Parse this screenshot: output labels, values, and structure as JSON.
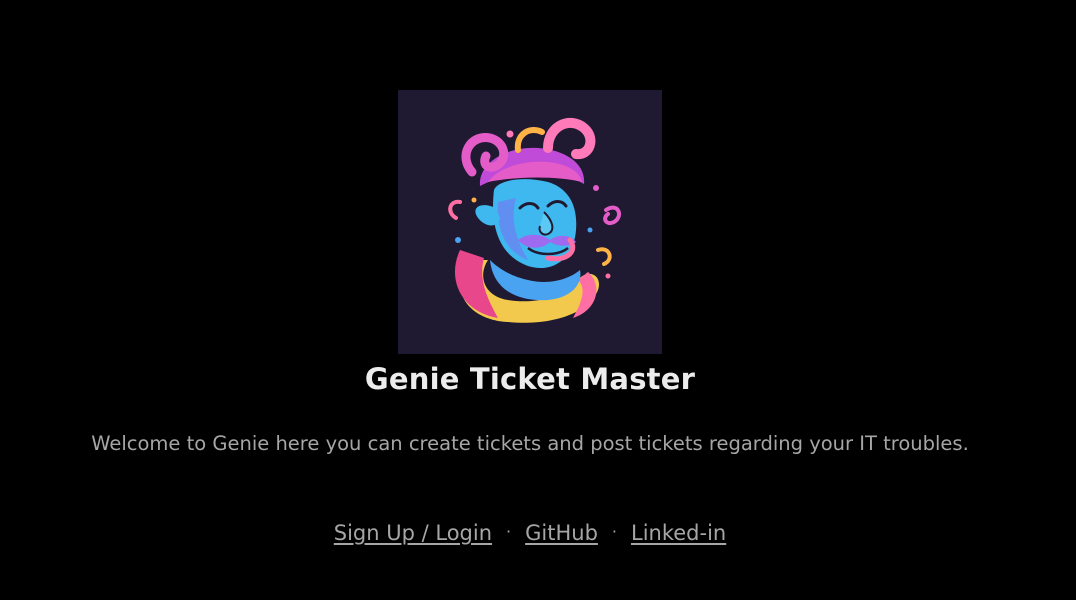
{
  "page": {
    "background_color": "#000000"
  },
  "logo": {
    "icon": "genie-logo-icon",
    "background_color": "#1f1a31"
  },
  "header": {
    "title": "Genie Ticket Master"
  },
  "main": {
    "welcome_text": "Welcome to Genie here you can create tickets and post tickets regarding your IT troubles."
  },
  "footer": {
    "links": [
      {
        "label": "Sign Up / Login"
      },
      {
        "label": "GitHub"
      },
      {
        "label": "Linked-in"
      }
    ],
    "separator": "·"
  }
}
